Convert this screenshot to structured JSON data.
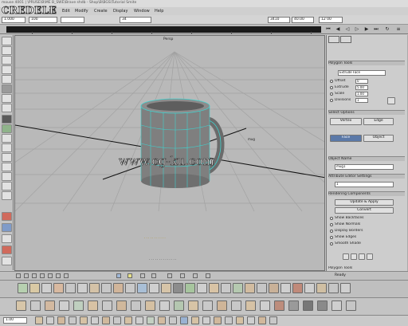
{
  "window": {
    "title": "mouse 4001 | \\PRUSE\\B\\ME B_SWE\\Brave shdb - Shop\\B\\BGS\\Tutorial Smite",
    "logo_text": "CREDELE"
  },
  "menu": [
    "File",
    "Edit",
    "Modify",
    "Create",
    "Display",
    "Window",
    "Help"
  ],
  "toolstrip": {
    "fields": [
      "1.000",
      "100",
      "",
      "34",
      "3410",
      "40.00",
      "12 00"
    ]
  },
  "viewport": {
    "label": "Persp",
    "object_label": "mug",
    "readout_1": "· · · · · · · · · · ·",
    "readout_2": "· · · · · · · · · · · · · ·",
    "watermark": "www.cg-ku.com",
    "colors": {
      "background": "#b9b9b9",
      "grid": "#a2a2a2",
      "mug_body": "#7f7f7f",
      "mug_wire": "#3fd2cf"
    }
  },
  "right_panel": {
    "section_title": "Polygon Tools",
    "subsection_title": "Extrude Face",
    "params": [
      {
        "label": "Offset",
        "value": "0"
      },
      {
        "label": "Extrude",
        "value": "5.00"
      },
      {
        "label": "Scale",
        "value": "1.00"
      },
      {
        "label": "Divisions",
        "value": "1"
      }
    ],
    "mode_header": "Select Options",
    "modes": [
      {
        "label": "Vertex",
        "selected": false
      },
      {
        "label": "Edge",
        "selected": false
      },
      {
        "label": "Face",
        "selected": true
      },
      {
        "label": "Object",
        "selected": false
      }
    ],
    "name_header": "Object Name",
    "name_value": "mug1",
    "attr_header": "Attribute Editor Settings",
    "attr_value": "1",
    "render_header": "Rendering Components",
    "render_btns": [
      "Update & Apply",
      "Convert"
    ],
    "checks": [
      "Show Backfaces",
      "Show Normals",
      "Display Borders",
      "Show Edges",
      "Smooth Shade"
    ],
    "footer": "Polygon Tools"
  },
  "status": {
    "left_text": "",
    "right_text": "Ready"
  },
  "bottom_bar": {
    "frame_field": "1.00"
  }
}
